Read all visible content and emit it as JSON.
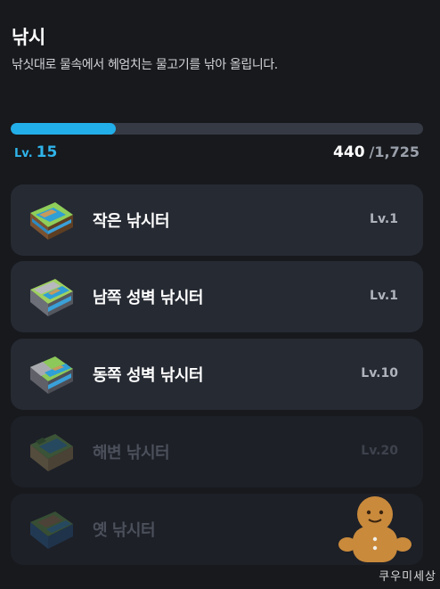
{
  "header": {
    "title": "낚시",
    "subtitle": "낚싯대로 물속에서 헤엄치는 물고기를 낚아 올립니다."
  },
  "progress": {
    "level_prefix": "Lv.",
    "level": "15",
    "exp_current": "440",
    "exp_separator": "/",
    "exp_max": "1,725",
    "fraction": 0.255,
    "color": "#22aee8"
  },
  "spots": [
    {
      "name": "작은 낚시터",
      "level_req": "Lv.1",
      "locked": false,
      "icon": "fishing-spot-small-icon"
    },
    {
      "name": "남쪽 성벽 낚시터",
      "level_req": "Lv.1",
      "locked": false,
      "icon": "fishing-spot-south-wall-icon"
    },
    {
      "name": "동쪽 성벽 낚시터",
      "level_req": "Lv.10",
      "locked": false,
      "icon": "fishing-spot-east-wall-icon"
    },
    {
      "name": "해변 낚시터",
      "level_req": "Lv.20",
      "locked": true,
      "icon": "fishing-spot-beach-icon"
    },
    {
      "name": "옛 낚시터",
      "level_req": "",
      "locked": true,
      "icon": "fishing-spot-old-icon"
    }
  ],
  "watermark": {
    "text": "쿠우미세상",
    "icon": "gingerbread-mascot-icon"
  }
}
